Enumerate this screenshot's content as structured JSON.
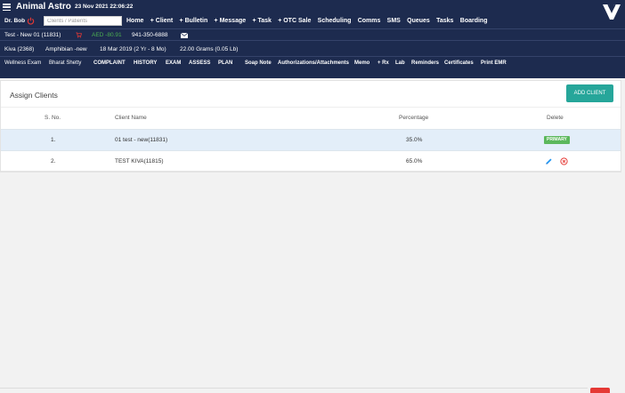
{
  "header": {
    "app_title": "Animal Astro",
    "datetime": "23 Nov 2021 22:06:22",
    "logo_icon": "brand-logo-icon"
  },
  "toolbar": {
    "doctor": "Dr. Bob",
    "search_placeholder": "Clients / Patients",
    "nav": [
      "Home",
      "+ Client",
      "+ Bulletin",
      "+ Message",
      "+ Task",
      "+ OTC Sale",
      "Scheduling",
      "Comms",
      "SMS",
      "Queues",
      "Tasks",
      "Boarding"
    ]
  },
  "client_bar": {
    "client": "Test - New 01 (11831)",
    "balance": "AED -80.91",
    "phone": "941-350-6888"
  },
  "patient_bar": {
    "patient": "Kiva (2368)",
    "species": "Amphibian -new",
    "dob": "18 Mar 2019 (2 Yr - 8 Mo)",
    "weight": "22.00 Grams (0.05 Lb)"
  },
  "visit_bar": {
    "visit": "Wellness Exam",
    "doctor": "Bharat Shetty",
    "tabs": [
      "COMPLAINT",
      "HISTORY",
      "EXAM",
      "ASSESS",
      "PLAN",
      "Soap Note",
      "Authorizations/Attachments",
      "Memo",
      "+ Rx",
      "Lab",
      "Reminders",
      "Certificates",
      "Print EMR"
    ]
  },
  "panel": {
    "title": "Assign Clients",
    "add_button": "ADD CLIENT",
    "columns": [
      "S. No.",
      "Client Name",
      "Percentage",
      "Delete"
    ],
    "rows": [
      {
        "sno": "1.",
        "name": "01 test - new(11831)",
        "percentage": "35.0%",
        "badge": "PRIMARY"
      },
      {
        "sno": "2.",
        "name": "TEST KIVA(11815)",
        "percentage": "65.0%"
      }
    ]
  },
  "colors": {
    "navbar": "#1d2b4f",
    "accent": "#26a69a",
    "primary_badge": "#5cb85c",
    "balance": "#4caf50",
    "delete": "#e53935"
  }
}
